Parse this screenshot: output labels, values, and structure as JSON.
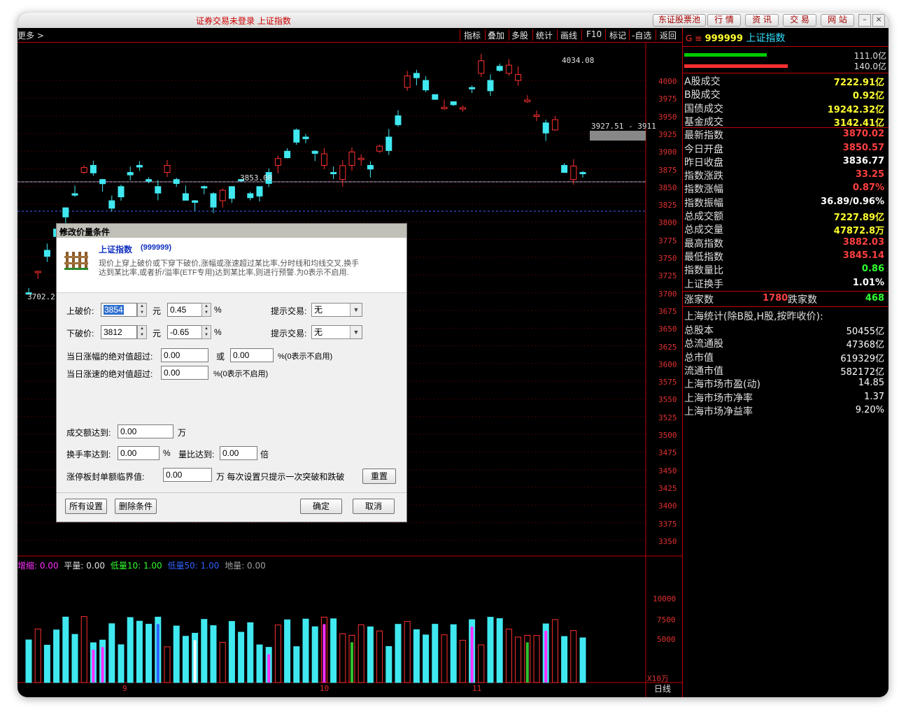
{
  "title_status": "证券交易未登录  上证指数",
  "top_buttons": [
    "东证股票池",
    "行 情",
    "资 讯",
    "交 易",
    "网 站"
  ],
  "toolbar": {
    "more": "更多 >",
    "items": [
      "指标",
      "叠加",
      "多股",
      "统计",
      "画线",
      "F10",
      "标记",
      "-自选",
      "返回"
    ]
  },
  "chart": {
    "y_ticks": [
      "4000",
      "3975",
      "3950",
      "3925",
      "3900",
      "3875",
      "3850",
      "3825",
      "3800",
      "3775",
      "3750",
      "3725",
      "3700",
      "3675",
      "3650",
      "3625",
      "3600",
      "3575",
      "3550",
      "3525",
      "3500",
      "3475",
      "3450",
      "3425",
      "3400",
      "3375",
      "3350"
    ],
    "high_label": "4034.08",
    "low_label": "3702.2",
    "mid_label": "3853.00",
    "range_label": "3927.51 - 3911",
    "volume_legend": {
      "a": "增缩: 0.00",
      "b": "平量: 0.00",
      "c": "低量10: 1.00",
      "d": "低量50: 1.00",
      "e": "地量: 0.00"
    },
    "vol_ticks": [
      "10000",
      "7500",
      "5000"
    ],
    "vol_unit": "X10万",
    "date_labels": [
      "9",
      "10",
      "11"
    ],
    "period": "日线"
  },
  "info": {
    "header_code": "999999",
    "header_name": "上证指数",
    "header_prefix": "G ≡",
    "bar_values": [
      "111.0亿",
      "140.0亿"
    ],
    "rows": [
      {
        "label": "A股成交",
        "value": "7222.91亿",
        "color": "#ffff30"
      },
      {
        "label": "B股成交",
        "value": "0.92亿",
        "color": "#ffff30"
      },
      {
        "label": "国债成交",
        "value": "19242.32亿",
        "color": "#ffff30"
      },
      {
        "label": "基金成交",
        "value": "3142.41亿",
        "color": "#ffff30"
      },
      {
        "label": "最新指数",
        "value": "3870.02",
        "color": "#ff4040"
      },
      {
        "label": "今日开盘",
        "value": "3850.57",
        "color": "#ff4040"
      },
      {
        "label": "昨日收盘",
        "value": "3836.77",
        "color": "#ffffff"
      },
      {
        "label": "指数涨跌",
        "value": "33.25",
        "color": "#ff4040"
      },
      {
        "label": "指数涨幅",
        "value": "0.87%",
        "color": "#ff4040"
      },
      {
        "label": "指数振幅",
        "value": "36.89/0.96%",
        "color": "#ffffff"
      },
      {
        "label": "总成交额",
        "value": "7227.89亿",
        "color": "#ffff30"
      },
      {
        "label": "总成交量",
        "value": "47872.8万",
        "color": "#ffff30"
      },
      {
        "label": "最高指数",
        "value": "3882.03",
        "color": "#ff4040"
      },
      {
        "label": "最低指数",
        "value": "3845.14",
        "color": "#ff4040"
      },
      {
        "label": "指数量比",
        "value": "0.86",
        "color": "#30ff30"
      },
      {
        "label": "上证换手",
        "value": "1.01%",
        "color": "#ffffff"
      }
    ],
    "up_label": "涨家数",
    "up_count": "1780",
    "down_label": "跌家数",
    "down_count": "468",
    "stats_title": "上海统计(除B股,H股,按昨收价):",
    "stats": [
      {
        "label": "总股本",
        "value": "50455亿"
      },
      {
        "label": "总流通股",
        "value": "47368亿"
      },
      {
        "label": "总市值",
        "value": "619329亿"
      },
      {
        "label": "流通市值",
        "value": "582172亿"
      },
      {
        "label": "上海市场市盈(动)",
        "value": "14.85"
      },
      {
        "label": "上海市场市净率",
        "value": "1.37"
      },
      {
        "label": "上海市场净益率",
        "value": "9.20%"
      }
    ]
  },
  "dialog": {
    "title": "修改价量条件",
    "stock_name": "上证指数",
    "stock_code": "(999999)",
    "desc1": "现价上穿上破价或下穿下破价,涨幅或涨速超过某比率,分时线和均线交叉,换手",
    "desc2": "达到某比率,或者折/溢率(ETF专用)达到某比率,则进行预警.为0表示不启用.",
    "upper_label": "上破价:",
    "upper_value": "3854",
    "yuan": "元",
    "upper_pct": "0.45",
    "pct": "%",
    "lower_label": "下破价:",
    "lower_value": "3812",
    "lower_pct": "-0.65",
    "prompt_label": "提示交易:",
    "prompt_value": "无",
    "abs_rise_label": "当日涨幅的绝对值超过:",
    "abs_rise_value": "0.00",
    "or": "或",
    "abs_rise_value2": "0.00",
    "zero_disabled": "%(0表示不启用)",
    "abs_speed_label": "当日涨速的绝对值超过:",
    "abs_speed_value": "0.00",
    "amount_label": "成交额达到:",
    "amount_value": "0.00",
    "wan": "万",
    "turnover_label": "换手率达到:",
    "turnover_value": "0.00",
    "ratio_label": "量比达到:",
    "ratio_value": "0.00",
    "bei": "倍",
    "limit_label": "涨停板封单额临界值:",
    "limit_value": "0.00",
    "limit_note": "万 每次设置只提示一次突破和跌破",
    "reset": "重置",
    "all_settings": "所有设置",
    "delete": "删除条件",
    "ok": "确定",
    "cancel": "取消"
  }
}
